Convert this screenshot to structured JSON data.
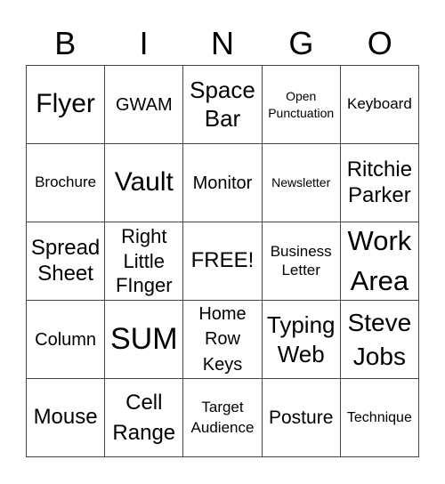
{
  "header": {
    "letters": [
      "B",
      "I",
      "N",
      "G",
      "O"
    ]
  },
  "card": {
    "rows": [
      [
        "Flyer",
        "GWAM",
        "Space\nBar",
        "Open\nPunctuation",
        "Keyboard"
      ],
      [
        "Brochure",
        "Vault",
        "Monitor",
        "Newsletter",
        "Ritchie\nParker"
      ],
      [
        "Spread\nSheet",
        "Right\nLittle\nFInger",
        "FREE!",
        "Business\nLetter",
        "Work\nArea"
      ],
      [
        "Column",
        "SUM",
        "Home\nRow\nKeys",
        "Typing\nWeb",
        "Steve\nJobs"
      ],
      [
        "Mouse",
        "Cell\nRange",
        "Target\nAudience",
        "Posture",
        "Technique"
      ]
    ]
  }
}
